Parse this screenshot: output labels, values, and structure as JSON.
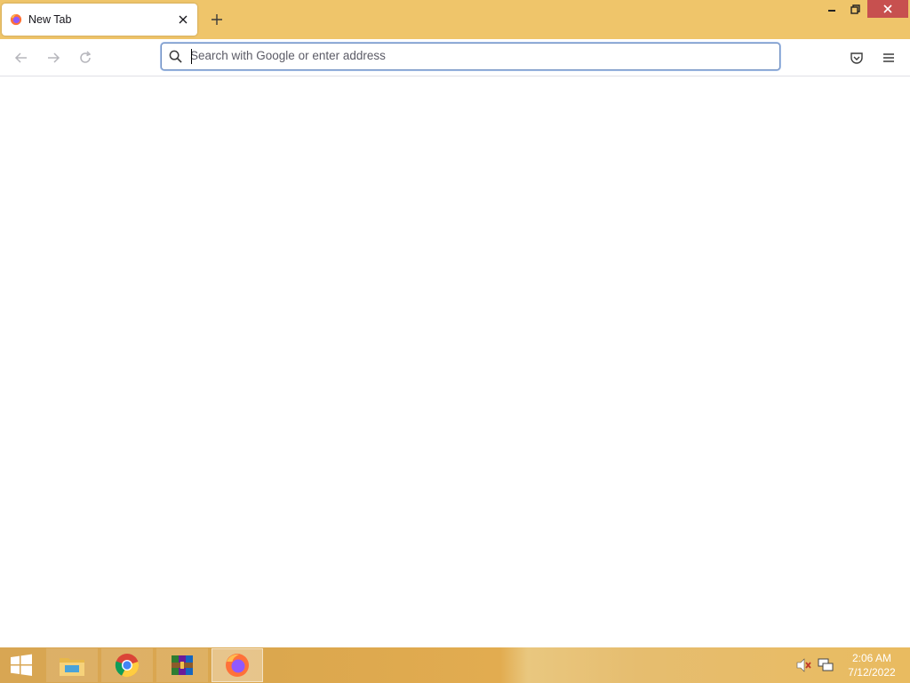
{
  "browser": {
    "tab": {
      "title": "New Tab",
      "favicon": "firefox-icon",
      "close_icon": "close-icon"
    },
    "new_tab_icon": "plus-icon",
    "window_controls": [
      "minimize-icon",
      "restore-icon",
      "close-icon"
    ],
    "toolbar": {
      "back_icon": "arrow-left-icon",
      "forward_icon": "arrow-right-icon",
      "reload_icon": "reload-icon",
      "pocket_icon": "pocket-icon",
      "menu_icon": "hamburger-menu-icon"
    },
    "urlbar": {
      "placeholder": "Search with Google or enter address",
      "value": ""
    }
  },
  "taskbar": {
    "apps": [
      {
        "name": "File Explorer",
        "icon": "folder-icon"
      },
      {
        "name": "Google Chrome",
        "icon": "chrome-icon"
      },
      {
        "name": "WinRAR",
        "icon": "winrar-icon"
      },
      {
        "name": "Firefox",
        "icon": "firefox-icon",
        "active": true
      }
    ],
    "tray": {
      "volume_icon": "volume-muted-icon",
      "network_icon": "network-icon"
    },
    "clock": {
      "time": "2:06 AM",
      "date": "7/12/2022"
    }
  },
  "colors": {
    "titlebar": "#efc56a",
    "close_button": "#c7504f",
    "urlbar_focus": "#6f8fc2"
  }
}
